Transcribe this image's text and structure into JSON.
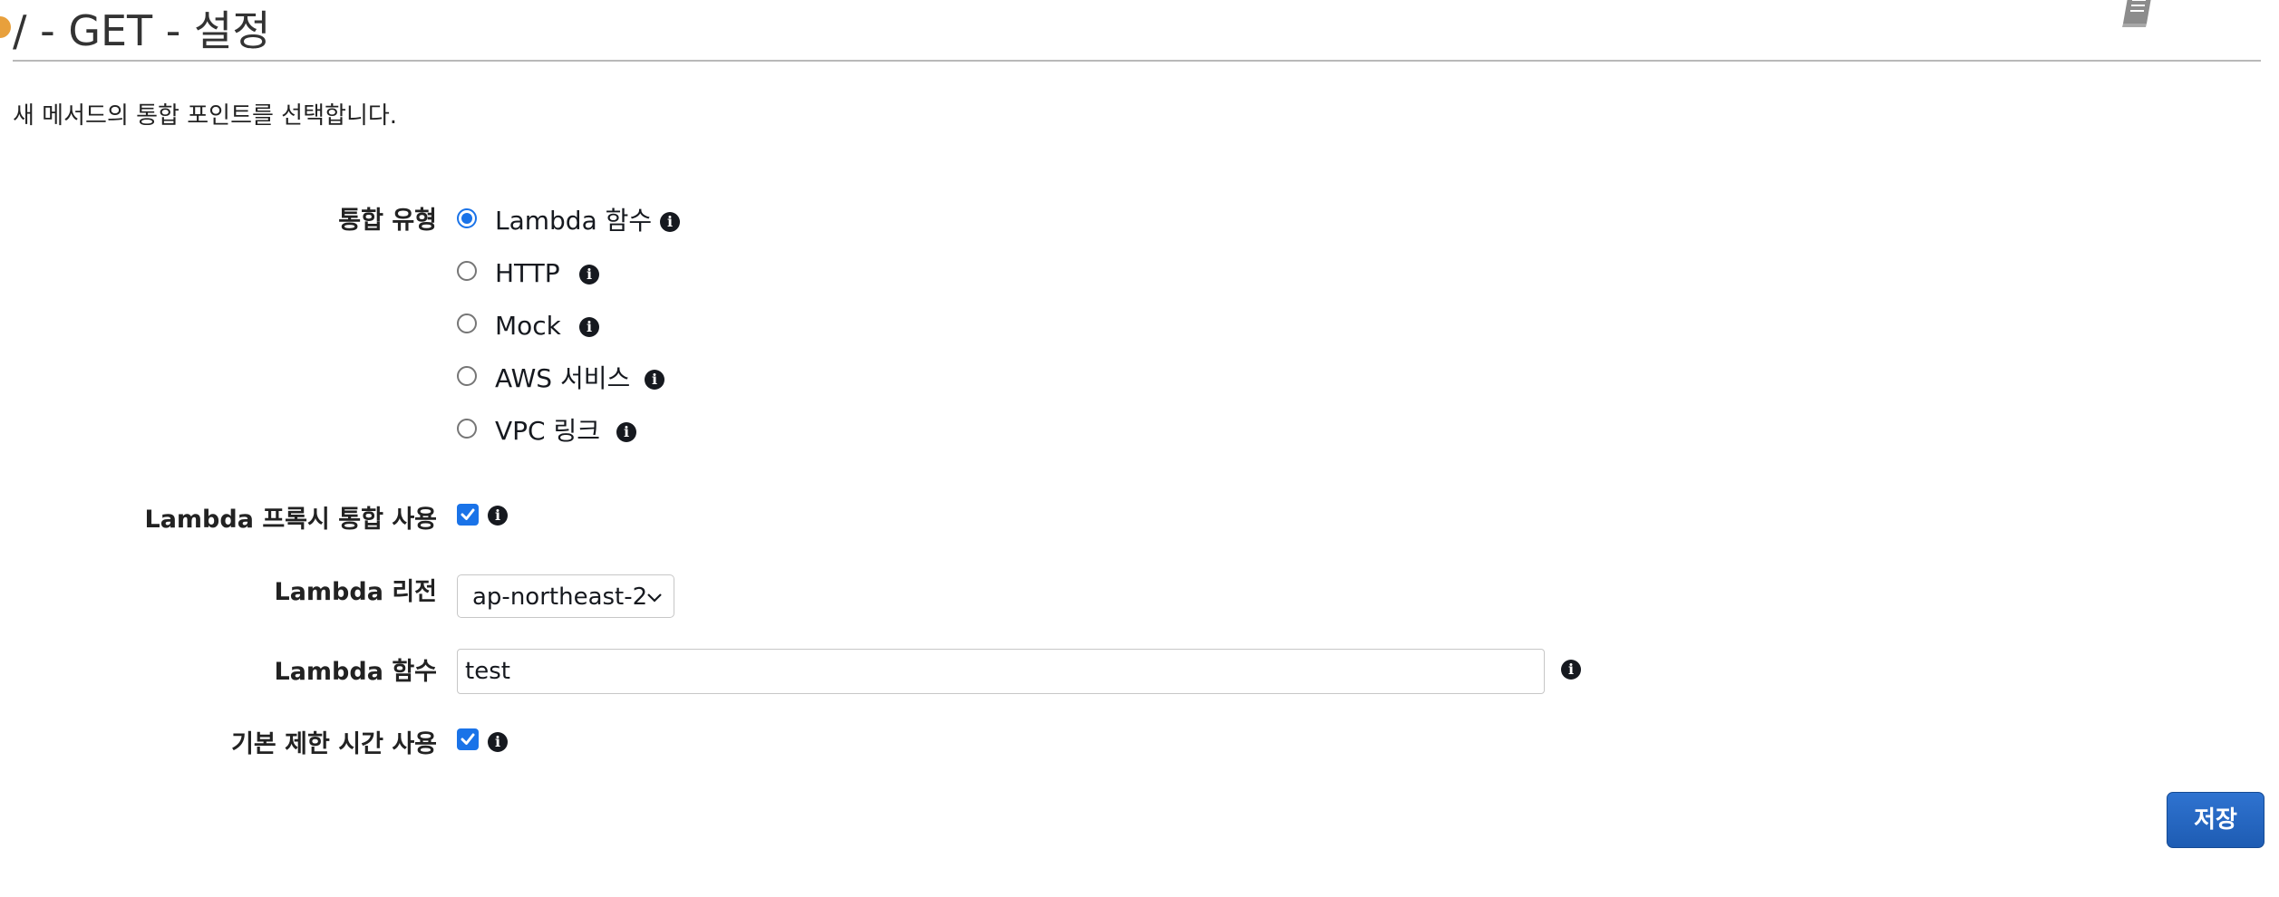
{
  "header": {
    "title": "/ - GET - 설정",
    "description": "새 메서드의 통합 포인트를 선택합니다.",
    "doc_icon": "book-icon"
  },
  "form": {
    "integration_type": {
      "label": "통합 유형",
      "options": [
        {
          "label": "Lambda 함수",
          "selected": true
        },
        {
          "label": "HTTP",
          "selected": false
        },
        {
          "label": "Mock",
          "selected": false
        },
        {
          "label": "AWS 서비스",
          "selected": false
        },
        {
          "label": "VPC 링크",
          "selected": false
        }
      ]
    },
    "proxy": {
      "label": "Lambda 프록시 통합 사용",
      "checked": true
    },
    "region": {
      "label": "Lambda 리전",
      "value": "ap-northeast-2"
    },
    "function": {
      "label": "Lambda 함수",
      "value": "test"
    },
    "timeout": {
      "label": "기본 제한 시간 사용",
      "checked": true
    },
    "info_glyph": "i"
  },
  "actions": {
    "save_label": "저장"
  },
  "colors": {
    "accent": "#1a73e8",
    "button": "#2f6fc7",
    "title_marker": "#e8a03c"
  }
}
